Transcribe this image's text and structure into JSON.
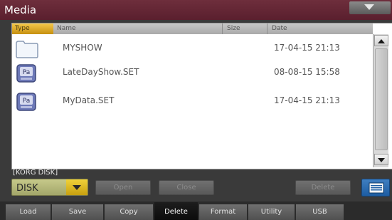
{
  "window": {
    "title": "Media"
  },
  "table": {
    "columns": {
      "type": "Type",
      "name": "Name",
      "size": "Size",
      "date": "Date"
    },
    "rows": [
      {
        "icon": "folder-icon",
        "name": "MYSHOW",
        "date": "17-04-15 21:13"
      },
      {
        "icon": "set-file-icon",
        "name": "LateDayShow.SET",
        "date": "08-08-15 15:58"
      },
      {
        "icon": "set-file-icon",
        "name": "MyData.SET",
        "date": "17-04-15 21:13"
      }
    ]
  },
  "device": {
    "label": "[KORG DISK]",
    "selected": "DISK"
  },
  "buttons": {
    "open": "Open",
    "close": "Close",
    "delete": "Delete"
  },
  "tabs": [
    {
      "label": "Load",
      "active": false
    },
    {
      "label": "Save",
      "active": false
    },
    {
      "label": "Copy",
      "active": false
    },
    {
      "label": "Delete",
      "active": true
    },
    {
      "label": "Format",
      "active": false
    },
    {
      "label": "Utility",
      "active": false
    },
    {
      "label": "USB",
      "active": false
    }
  ],
  "colors": {
    "title_bar": "#5a1f2e",
    "type_header": "#e2ad20",
    "device_select": "#b7ba7a",
    "settings_button": "#2b6db2"
  }
}
